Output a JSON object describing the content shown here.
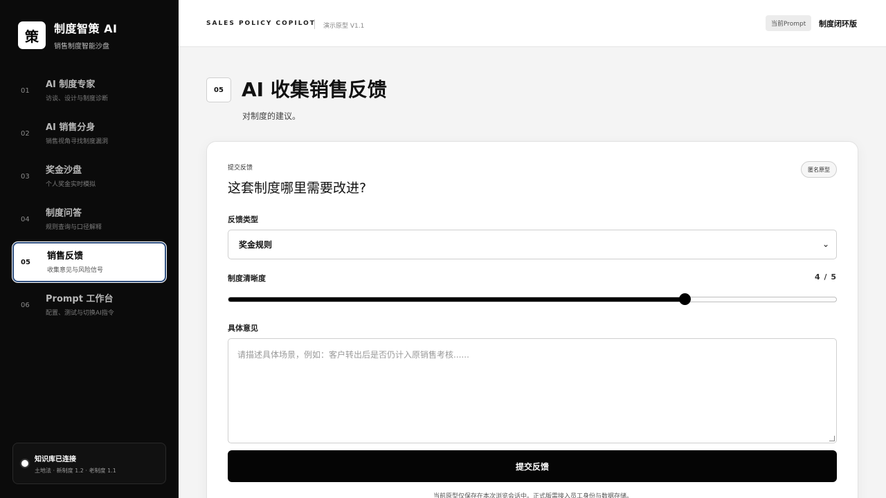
{
  "brand": {
    "logo": "策",
    "title": "制度智策 AI",
    "subtitle": "销售制度智能沙盘"
  },
  "nav": [
    {
      "num": "01",
      "label": "AI 制度专家",
      "desc": "访谈、设计与制度诊断"
    },
    {
      "num": "02",
      "label": "AI 销售分身",
      "desc": "销售视角寻找制度漏洞"
    },
    {
      "num": "03",
      "label": "奖金沙盘",
      "desc": "个人奖金实时模拟"
    },
    {
      "num": "04",
      "label": "制度问答",
      "desc": "规则查询与口径解释"
    },
    {
      "num": "05",
      "label": "销售反馈",
      "desc": "收集意见与风险信号"
    },
    {
      "num": "06",
      "label": "Prompt 工作台",
      "desc": "配置、测试与切换AI指令"
    }
  ],
  "knowledge": {
    "title": "知识库已连接",
    "sub": "土地法 · 新制度 1.2 · 老制度 1.1"
  },
  "header": {
    "brand": "SALES POLICY COPILOT",
    "version": "演示原型 V1.1",
    "prompt_pill": "当前Prompt",
    "mode": "制度闭环版"
  },
  "page": {
    "num": "05",
    "title": "AI 收集销售反馈",
    "subtitle": "对制度的建议。"
  },
  "form": {
    "kicker": "提交反馈",
    "question": "这套制度哪里需要改进?",
    "anon": "匿名原型",
    "type_label": "反馈类型",
    "type_value": "奖金规则",
    "clarity_label": "制度清晰度",
    "clarity_display": "4 / 5",
    "clarity_value": 4,
    "clarity_max": 5,
    "clarity_min": 1,
    "comment_label": "具体意见",
    "comment_placeholder": "请描述具体场景，例如：客户转出后是否仍计入原销售考核......",
    "submit": "提交反馈",
    "footnote": "当前原型仅保存在本次浏览会话中。正式版需接入员工身份与数据存储。"
  },
  "colors": {
    "sidebar_bg": "#0b0b0b",
    "active_border": "#2f4f7f",
    "primary": "#050505"
  }
}
